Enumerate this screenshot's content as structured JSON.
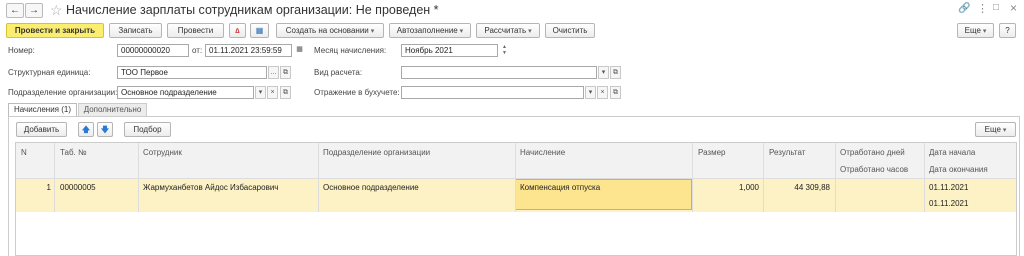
{
  "title": "Начисление зарплаты сотрудникам организации: Не проведен *",
  "toolbar": {
    "post_close": "Провести и закрыть",
    "save": "Записать",
    "post": "Провести",
    "create_based": "Создать на основании",
    "autofill": "Автозаполнение",
    "calculate": "Рассчитать",
    "clear": "Очистить",
    "more": "Еще",
    "help": "?"
  },
  "form": {
    "number_label": "Номер:",
    "number_value": "00000000020",
    "from_label": "от:",
    "date_value": "01.11.2021 23:59:59",
    "month_label": "Месяц начисления:",
    "month_value": "Ноябрь 2021",
    "unit_label": "Структурная единица:",
    "unit_value": "ТОО Первое",
    "calc_type_label": "Вид расчета:",
    "calc_type_value": "",
    "dept_label": "Подразделение организации:",
    "dept_value": "Основное подразделение",
    "accounting_label": "Отражение в бухучете:",
    "accounting_value": ""
  },
  "tabs": [
    {
      "label": "Начисления (1)",
      "active": true
    },
    {
      "label": "Дополнительно",
      "active": false
    }
  ],
  "table_toolbar": {
    "add": "Добавить",
    "selection": "Подбор",
    "more": "Еще"
  },
  "table": {
    "headers": {
      "n": "N",
      "tab": "Таб. №",
      "employee": "Сотрудник",
      "dept": "Подразделение организации",
      "accrual": "Начисление",
      "size": "Размер",
      "result": "Результат",
      "days": "Отработано дней",
      "hours": "Отработано часов",
      "start": "Дата начала",
      "end": "Дата окончания"
    },
    "rows": [
      {
        "n": "1",
        "tab": "00000005",
        "employee": "Жармуханбетов Айдос Избасарович",
        "dept": "Основное подразделение",
        "accrual": "Компенсация отпуска",
        "size": "1,000",
        "result": "44 309,88",
        "days": "",
        "hours": "",
        "start": "01.11.2021",
        "end": "01.11.2021"
      }
    ]
  },
  "colors": {
    "accent": "#fbed70",
    "row_selected": "#fcf2c6",
    "cell_active": "#fde590"
  },
  "icons": [
    "arrow-left-icon",
    "arrow-right-icon",
    "star-icon",
    "link-icon",
    "more-vert-icon",
    "maximize-icon",
    "close-icon",
    "dt-kt-icon",
    "report-icon",
    "calendar-icon",
    "arrow-up-icon",
    "arrow-down-icon"
  ]
}
